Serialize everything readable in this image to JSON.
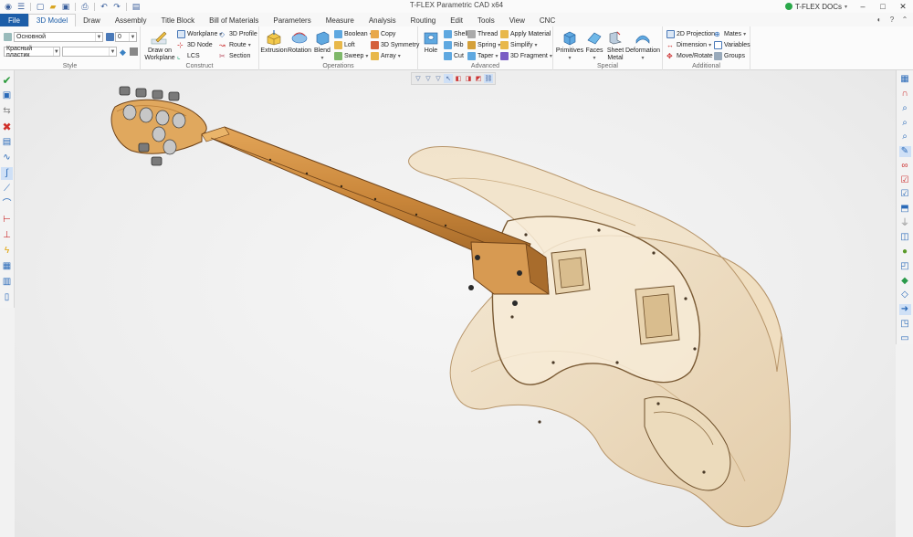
{
  "app": {
    "title": "T-FLEX Parametric CAD x64",
    "docs_label": "T-FLEX DOCs"
  },
  "window_controls": [
    "–",
    "□",
    "✕"
  ],
  "quick_access": [
    "app-menu-icon",
    "menu-icon",
    "new-icon",
    "open-icon",
    "save-icon",
    "print-icon",
    "undo-icon",
    "redo-icon",
    "page-icon"
  ],
  "tabs": [
    {
      "label": "File",
      "kind": "file"
    },
    {
      "label": "3D Model",
      "kind": "active"
    },
    {
      "label": "Draw"
    },
    {
      "label": "Assembly"
    },
    {
      "label": "Title Block"
    },
    {
      "label": "Bill of Materials"
    },
    {
      "label": "Parameters"
    },
    {
      "label": "Measure"
    },
    {
      "label": "Analysis"
    },
    {
      "label": "Routing"
    },
    {
      "label": "Edit"
    },
    {
      "label": "Tools"
    },
    {
      "label": "View"
    },
    {
      "label": "CNC"
    }
  ],
  "ribbon": {
    "style": {
      "title": "Style",
      "layer_value": "Основной",
      "number_value": "0",
      "material_value": "Красный пластик",
      "second_combo_value": ""
    },
    "construct": {
      "title": "Construct",
      "draw_on_workplane": "Draw on\nWorkplane",
      "workplane": "Workplane",
      "node_3d": "3D Node",
      "lcs": "LCS",
      "profile_3d": "3D Profile",
      "route": "Route",
      "section": "Section"
    },
    "operations": {
      "title": "Operations",
      "extrusion": "Extrusion",
      "rotation": "Rotation",
      "blend": "Blend",
      "boolean": "Boolean",
      "loft": "Loft",
      "sweep": "Sweep",
      "copy": "Copy",
      "symmetry_3d": "3D Symmetry",
      "array": "Array"
    },
    "advanced": {
      "title": "Advanced",
      "hole": "Hole",
      "shell": "Shell",
      "rib": "Rib",
      "cut": "Cut",
      "thread": "Thread",
      "spring": "Spring",
      "taper": "Taper",
      "apply_material": "Apply Material",
      "simplify": "Simplify",
      "fragment_3d": "3D Fragment"
    },
    "special": {
      "title": "Special",
      "primitives": "Primitives",
      "faces": "Faces",
      "sheet_metal": "Sheet\nMetal",
      "deformation": "Deformation"
    },
    "additional": {
      "title": "Additional",
      "projection_2d": "2D Projection",
      "dimension": "Dimension",
      "move_rotate": "Move/Rotate",
      "mates": "Mates",
      "variables": "Variables",
      "groups": "Groups"
    }
  },
  "view_toolbar": [
    "filter-icon",
    "filter-icon",
    "filter-icon",
    "cursor-icon",
    "select-icon",
    "select-icon",
    "select-icon",
    "link-icon"
  ],
  "left_toolbar": [
    "confirm-icon",
    "properties-icon",
    "move-icon",
    "cancel-icon",
    "view-icon",
    "curve-icon",
    "spline-icon",
    "line-icon",
    "arc-icon",
    "measure-icon",
    "dimension-icon",
    "lightning-icon",
    "paste-icon",
    "list-icon",
    "book-icon"
  ],
  "right_toolbar": [
    "window-icon",
    "magnet-icon",
    "zoom-icon",
    "zoom-icon",
    "zoom-icon",
    "text-icon",
    "glasses-icon",
    "check-icon",
    "check-icon",
    "view-cube-icon",
    "filter-icon",
    "cube-icon",
    "sphere-icon",
    "cube-icon",
    "cube-icon",
    "shape-icon",
    "arrow-icon",
    "cube-icon",
    "screen-icon"
  ],
  "colors": {
    "file_tab": "#1d5ea8",
    "accent": "#1d5ea8",
    "neck_wood": "#cc8a3c",
    "body_wood": "#ead4b1"
  }
}
